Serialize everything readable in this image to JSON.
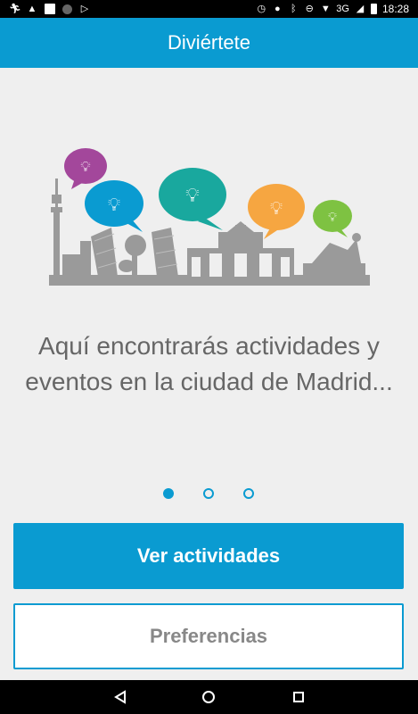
{
  "status_bar": {
    "time": "18:28",
    "network": "3G",
    "icons_left": [
      "runner-icon",
      "warning-icon",
      "square-icon",
      "circle-icon",
      "play-store-icon"
    ],
    "icons_right": [
      "alarm-icon",
      "location-icon",
      "bluetooth-icon",
      "do-not-disturb-icon",
      "wifi-icon",
      "signal-icon",
      "battery-icon"
    ]
  },
  "app_bar": {
    "title": "Diviértete"
  },
  "onboarding": {
    "message": "Aquí encontrarás actividades y eventos en la ciudad de Madrid...",
    "page_count": 3,
    "current_page": 1
  },
  "buttons": {
    "primary": "Ver actividades",
    "secondary": "Preferencias"
  },
  "colors": {
    "primary": "#0a9bd1",
    "bubble_magenta": "#a3479b",
    "bubble_blue": "#0a9bd1",
    "bubble_teal": "#19a89e",
    "bubble_orange": "#f6a641",
    "bubble_green": "#7ec242",
    "skyline_gray": "#9a9a9a"
  }
}
